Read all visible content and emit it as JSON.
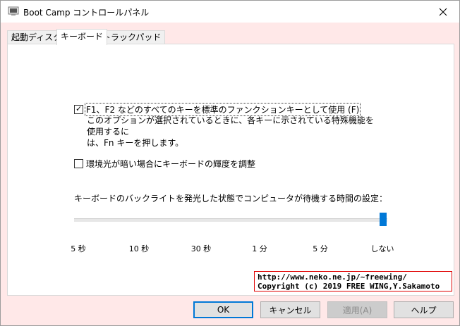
{
  "window": {
    "title": "Boot Camp コントロールパネル"
  },
  "tabs": [
    {
      "label": "起動ディスク"
    },
    {
      "label": "キーボード"
    },
    {
      "label": "トラックパッド"
    }
  ],
  "keyboard": {
    "fn_option": {
      "label": "F1、F2 などのすべてのキーを標準のファンクションキーとして使用 (F)",
      "checked": true,
      "description_line1": "このオプションが選択されているときに、各キーに示されている特殊機能を使用するに",
      "description_line2": "は、Fn キーを押します。"
    },
    "brightness_option": {
      "label": "環境光が暗い場合にキーボードの輝度を調整",
      "checked": false
    },
    "backlight": {
      "label": "キーボードのバックライトを発光した状態でコンピュータが待機する時間の設定：",
      "ticks": [
        "5 秒",
        "10 秒",
        "30 秒",
        "1 分",
        "5 分",
        "しない"
      ],
      "selected": "しない"
    }
  },
  "watermark": {
    "line1": "http://www.neko.ne.jp/~freewing/",
    "line2": "Copyright (c) 2019 FREE WING,Y.Sakamoto"
  },
  "buttons": {
    "ok": "OK",
    "cancel": "キャンセル",
    "apply": "適用(A)",
    "help": "ヘルプ"
  },
  "colors": {
    "accent": "#0078d7",
    "background": "#ffe8e8",
    "watermark_border": "#e00000"
  }
}
